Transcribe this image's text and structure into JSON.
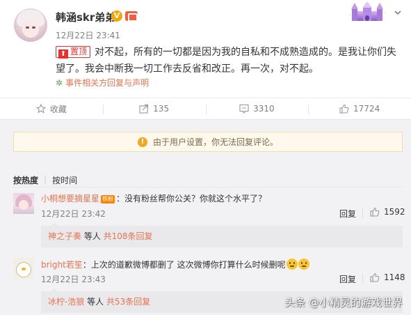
{
  "post": {
    "username": "韩涵skr弟弟",
    "vip_badge": "V",
    "time": "12月22日 23:41",
    "pinned_label": "置顶",
    "text": "对不起，所有的一切都是因为我的自私和不成熟造成的。是我让你们失望了。我会中断我一切工作去反省和改正。再一次，对不起。",
    "source": "事件相关方回复与声明"
  },
  "actions": {
    "favorite": "收藏",
    "repost": "135",
    "comment": "3310",
    "like": "17724"
  },
  "notice": {
    "text": "由于用户设置，你无法回复评论。",
    "icon": "!"
  },
  "sort": {
    "hot": "按热度",
    "time": "按时间",
    "separator": "|"
  },
  "comments": [
    {
      "user": "小桐想要摘星星",
      "fan_badge": "铁粉",
      "text": "：没有粉丝帮你公关？你就这个水平了？",
      "time": "12月22日 23:42",
      "reply_label": "回复",
      "likes": "1592",
      "subreply_user": "神之子奏",
      "subreply_mid": " 等人 ",
      "subreply_count": "共108条回复"
    },
    {
      "user": "bright若笙",
      "text": "：上次的道歉微博都删了  这次微博你打算什么时候删呢",
      "time": "12月22日 23:43",
      "reply_label": "回复",
      "likes": "1148",
      "subreply_user": "冰柠-浩狼",
      "subreply_mid": " 等人 ",
      "subreply_count": "共53条回复"
    }
  ],
  "watermark": "头条 @小精灵的游戏世界",
  "colors": {
    "accent": "#eb7350",
    "pin_red": "#e8312d",
    "vip": "#f7a800",
    "gray_bg": "#f2f2f5"
  },
  "icons": [
    "vip-icon",
    "level-icon",
    "castle-icon",
    "chevron-down-icon",
    "pin-icon",
    "spark-icon",
    "star-icon",
    "repost-icon",
    "comment-icon",
    "thumbs-up-icon",
    "warning-icon",
    "emoji-icon"
  ]
}
